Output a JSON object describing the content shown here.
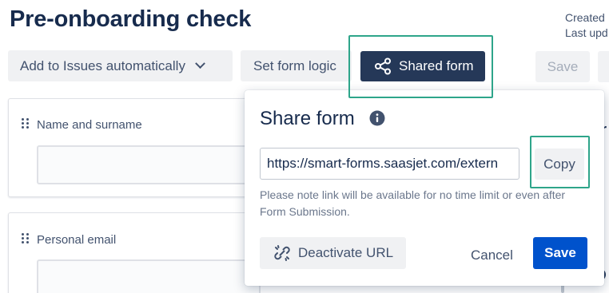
{
  "page": {
    "title": "Pre-onboarding check",
    "meta_created": "Created",
    "meta_updated": "Last upd"
  },
  "toolbar": {
    "add_issues_label": "Add to Issues automatically",
    "form_logic_label": "Set form logic",
    "shared_form_label": "Shared form",
    "save_label": "Save"
  },
  "form": {
    "fields": [
      {
        "label": "Name and surname"
      },
      {
        "label": "Personal email"
      }
    ]
  },
  "share_popup": {
    "title": "Share form",
    "url_value": "https://smart-forms.saasjet.com/extern",
    "copy_label": "Copy",
    "note": "Please note link will be available for no time limit or even after Form Submission.",
    "deactivate_label": "Deactivate URL",
    "cancel_label": "Cancel",
    "save_label": "Save"
  },
  "edge": {
    "right_char": "r"
  },
  "icons": {
    "dropdown": "chevron-down-icon",
    "share": "share-icon",
    "info": "info-icon",
    "drag": "drag-handle-icon",
    "unlink": "unlink-icon"
  },
  "colors": {
    "primary_dark": "#253858",
    "primary_blue": "#0052cc",
    "highlight": "#2ea58a",
    "neutral_bg": "#f0f1f3"
  }
}
